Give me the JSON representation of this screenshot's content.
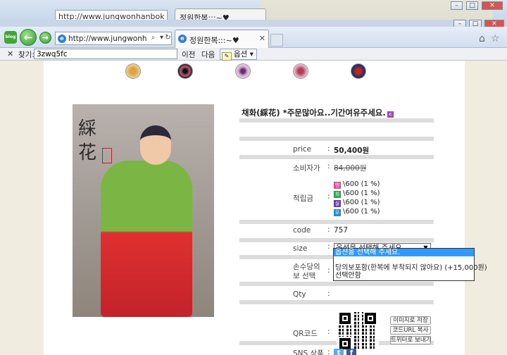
{
  "browser": {
    "blog_badge": "blog",
    "url": "http://www.jungwonhanbok",
    "tab_title": "정원한복:::~♥",
    "find_label": "찾기:",
    "find_value": "3zwq5fc",
    "find_prev": "이전",
    "find_next": "다음",
    "find_options": "옵션"
  },
  "product": {
    "title": "채화(綵花) *주문많아요..기간여유주세요.",
    "photo_calligraphy": "綵花",
    "rows": {
      "price_label": "price",
      "price_value": "50,400원",
      "consumer_label": "소비자가",
      "consumer_value": "84,000원",
      "points_label": "적립금",
      "points": [
        {
          "badge": "앤",
          "color": "#e0489a",
          "text": "\\600 (1 %)"
        },
        {
          "badge": "회",
          "color": "#2aa24a",
          "text": "\\600 (1 %)"
        },
        {
          "badge": "실",
          "color": "#6a3aa8",
          "text": "\\600 (1 %)"
        },
        {
          "badge": "우",
          "color": "#2a8ad0",
          "text": "\\600 (1 %)"
        }
      ],
      "code_label": "code",
      "code_value": "757",
      "size_label": "size",
      "size_value": "옵션을 선택해 주세요.",
      "handmade_label": "손수당의 보 선택",
      "qty_label": "Qty",
      "qr_label": "QR코드",
      "sns_label": "SNS 상품"
    },
    "colon": ":",
    "qr_buttons": [
      "이미지로 저장",
      "코드URL 복사",
      "트위터로 보내기"
    ],
    "dropdown_options": [
      "옵션을 선택해 주세요.",
      "",
      "당의보포함(한복에 부착되지 않아요) (+15,000원)",
      "선택안함"
    ]
  }
}
